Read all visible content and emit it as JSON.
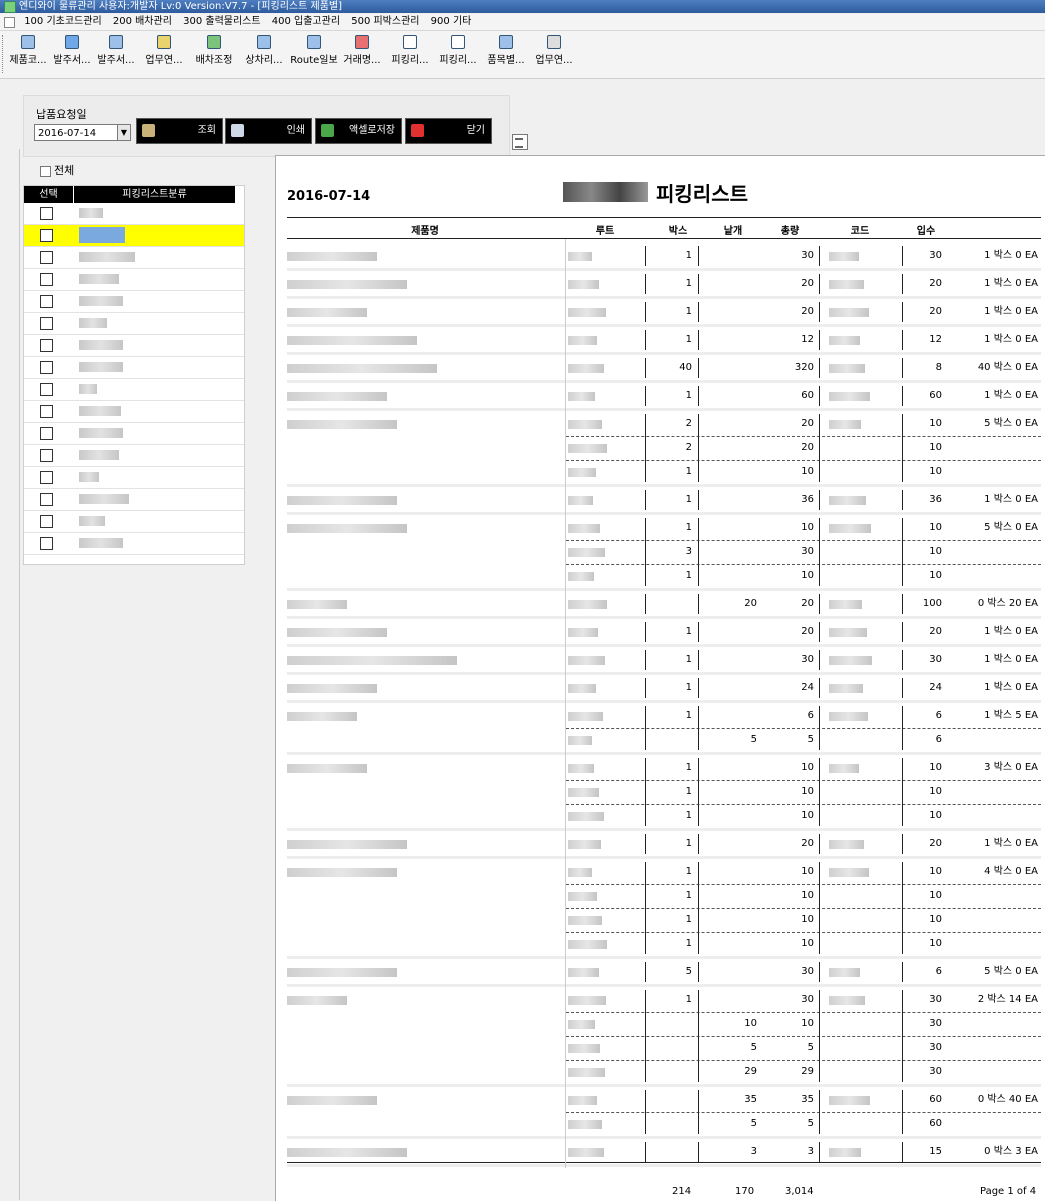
{
  "window": {
    "title": "엔디와이 물류관리 사용자:개발자 Lv:0  Version:V7.7 - [피킹리스트 제품별]"
  },
  "menu": [
    "100 기초코드관리",
    "200 배차관리",
    "300 출력물리스트",
    "400 입출고관리",
    "500 피박스관리",
    "900 기타"
  ],
  "toolbar": [
    "제품코...",
    "발주서...",
    "발주서...",
    "업무연...",
    "배차조정",
    "상차리...",
    "Route일보",
    "거래명...",
    "피킹리...",
    "피킹리...",
    "품목별...",
    "업무연..."
  ],
  "filter": {
    "date_label": "납품요청일",
    "date_value": "2016-07-14",
    "search_label": "조회",
    "print_label": "인쇄",
    "excel_label": "액셀로저장",
    "close_label": "닫기"
  },
  "left": {
    "check_all_label": "전체",
    "col_select": "선택",
    "col_category": "피킹리스트분류",
    "rows": 16,
    "selected_index": 1
  },
  "report": {
    "date": "2016-07-14",
    "title": "피킹리스트",
    "headers": [
      "제품명",
      "루트",
      "박스",
      "낱개",
      "총량",
      "코드",
      "입수"
    ],
    "groups": [
      {
        "rows": [
          {
            "box": "1",
            "piece": "",
            "total": "30",
            "ipsu": "30"
          }
        ],
        "summary": "1 박스 0 EA"
      },
      {
        "rows": [
          {
            "box": "1",
            "piece": "",
            "total": "20",
            "ipsu": "20"
          }
        ],
        "summary": "1 박스 0 EA"
      },
      {
        "rows": [
          {
            "box": "1",
            "piece": "",
            "total": "20",
            "ipsu": "20"
          }
        ],
        "summary": "1 박스 0 EA"
      },
      {
        "rows": [
          {
            "box": "1",
            "piece": "",
            "total": "12",
            "ipsu": "12"
          }
        ],
        "summary": "1 박스 0 EA"
      },
      {
        "rows": [
          {
            "box": "40",
            "piece": "",
            "total": "320",
            "ipsu": "8"
          }
        ],
        "summary": "40 박스 0 EA"
      },
      {
        "rows": [
          {
            "box": "1",
            "piece": "",
            "total": "60",
            "ipsu": "60"
          }
        ],
        "summary": "1 박스 0 EA"
      },
      {
        "rows": [
          {
            "box": "2",
            "piece": "",
            "total": "20",
            "ipsu": "10"
          },
          {
            "box": "2",
            "piece": "",
            "total": "20",
            "ipsu": "10"
          },
          {
            "box": "1",
            "piece": "",
            "total": "10",
            "ipsu": "10"
          }
        ],
        "summary": "5 박스 0 EA"
      },
      {
        "rows": [
          {
            "box": "1",
            "piece": "",
            "total": "36",
            "ipsu": "36"
          }
        ],
        "summary": "1 박스 0 EA"
      },
      {
        "rows": [
          {
            "box": "1",
            "piece": "",
            "total": "10",
            "ipsu": "10"
          },
          {
            "box": "3",
            "piece": "",
            "total": "30",
            "ipsu": "10"
          },
          {
            "box": "1",
            "piece": "",
            "total": "10",
            "ipsu": "10"
          }
        ],
        "summary": "5 박스 0 EA"
      },
      {
        "rows": [
          {
            "box": "",
            "piece": "20",
            "total": "20",
            "ipsu": "100"
          }
        ],
        "summary": "0 박스 20 EA"
      },
      {
        "rows": [
          {
            "box": "1",
            "piece": "",
            "total": "20",
            "ipsu": "20"
          }
        ],
        "summary": "1 박스 0 EA"
      },
      {
        "rows": [
          {
            "box": "1",
            "piece": "",
            "total": "30",
            "ipsu": "30"
          }
        ],
        "summary": "1 박스 0 EA"
      },
      {
        "rows": [
          {
            "box": "1",
            "piece": "",
            "total": "24",
            "ipsu": "24"
          }
        ],
        "summary": "1 박스 0 EA"
      },
      {
        "rows": [
          {
            "box": "1",
            "piece": "",
            "total": "6",
            "ipsu": "6"
          },
          {
            "box": "",
            "piece": "5",
            "total": "5",
            "ipsu": "6"
          }
        ],
        "summary": "1 박스 5 EA"
      },
      {
        "rows": [
          {
            "box": "1",
            "piece": "",
            "total": "10",
            "ipsu": "10"
          },
          {
            "box": "1",
            "piece": "",
            "total": "10",
            "ipsu": "10"
          },
          {
            "box": "1",
            "piece": "",
            "total": "10",
            "ipsu": "10"
          }
        ],
        "summary": "3 박스 0 EA"
      },
      {
        "rows": [
          {
            "box": "1",
            "piece": "",
            "total": "20",
            "ipsu": "20"
          }
        ],
        "summary": "1 박스 0 EA"
      },
      {
        "rows": [
          {
            "box": "1",
            "piece": "",
            "total": "10",
            "ipsu": "10"
          },
          {
            "box": "1",
            "piece": "",
            "total": "10",
            "ipsu": "10"
          },
          {
            "box": "1",
            "piece": "",
            "total": "10",
            "ipsu": "10"
          },
          {
            "box": "1",
            "piece": "",
            "total": "10",
            "ipsu": "10"
          }
        ],
        "summary": "4 박스 0 EA"
      },
      {
        "rows": [
          {
            "box": "5",
            "piece": "",
            "total": "30",
            "ipsu": "6"
          }
        ],
        "summary": "5 박스 0 EA"
      },
      {
        "rows": [
          {
            "box": "1",
            "piece": "",
            "total": "30",
            "ipsu": "30"
          },
          {
            "box": "",
            "piece": "10",
            "total": "10",
            "ipsu": "30"
          },
          {
            "box": "",
            "piece": "5",
            "total": "5",
            "ipsu": "30"
          },
          {
            "box": "",
            "piece": "29",
            "total": "29",
            "ipsu": "30"
          }
        ],
        "summary": "2 박스 14 EA"
      },
      {
        "rows": [
          {
            "box": "",
            "piece": "35",
            "total": "35",
            "ipsu": "60"
          },
          {
            "box": "",
            "piece": "5",
            "total": "5",
            "ipsu": "60"
          }
        ],
        "summary": "0 박스 40 EA"
      },
      {
        "rows": [
          {
            "box": "",
            "piece": "3",
            "total": "3",
            "ipsu": "15"
          }
        ],
        "summary": "0 박스 3 EA"
      }
    ],
    "totals": {
      "box": "214",
      "piece": "170",
      "total": "3,014"
    },
    "page": "Page 1 of 4"
  }
}
